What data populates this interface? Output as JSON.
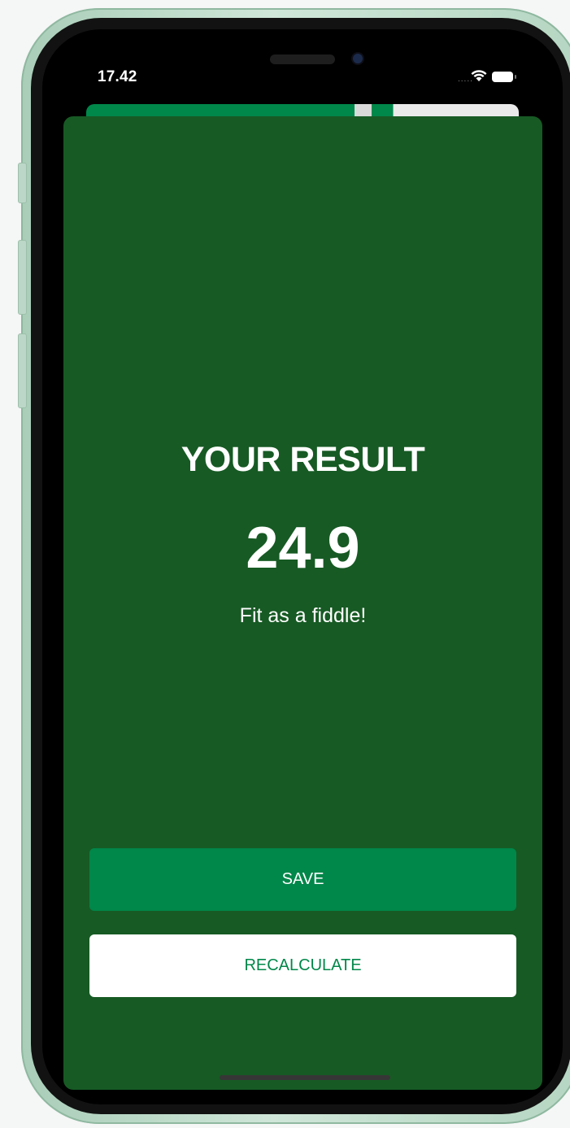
{
  "status_bar": {
    "time": "17.42"
  },
  "result": {
    "title": "YOUR RESULT",
    "value": "24.9",
    "message": "Fit as a fiddle!"
  },
  "actions": {
    "save_label": "SAVE",
    "recalculate_label": "RECALCULATE"
  },
  "colors": {
    "modal_background": "#175a24",
    "accent": "#00874a",
    "text": "#ffffff"
  },
  "icons": [
    "wifi-icon",
    "battery-icon"
  ]
}
